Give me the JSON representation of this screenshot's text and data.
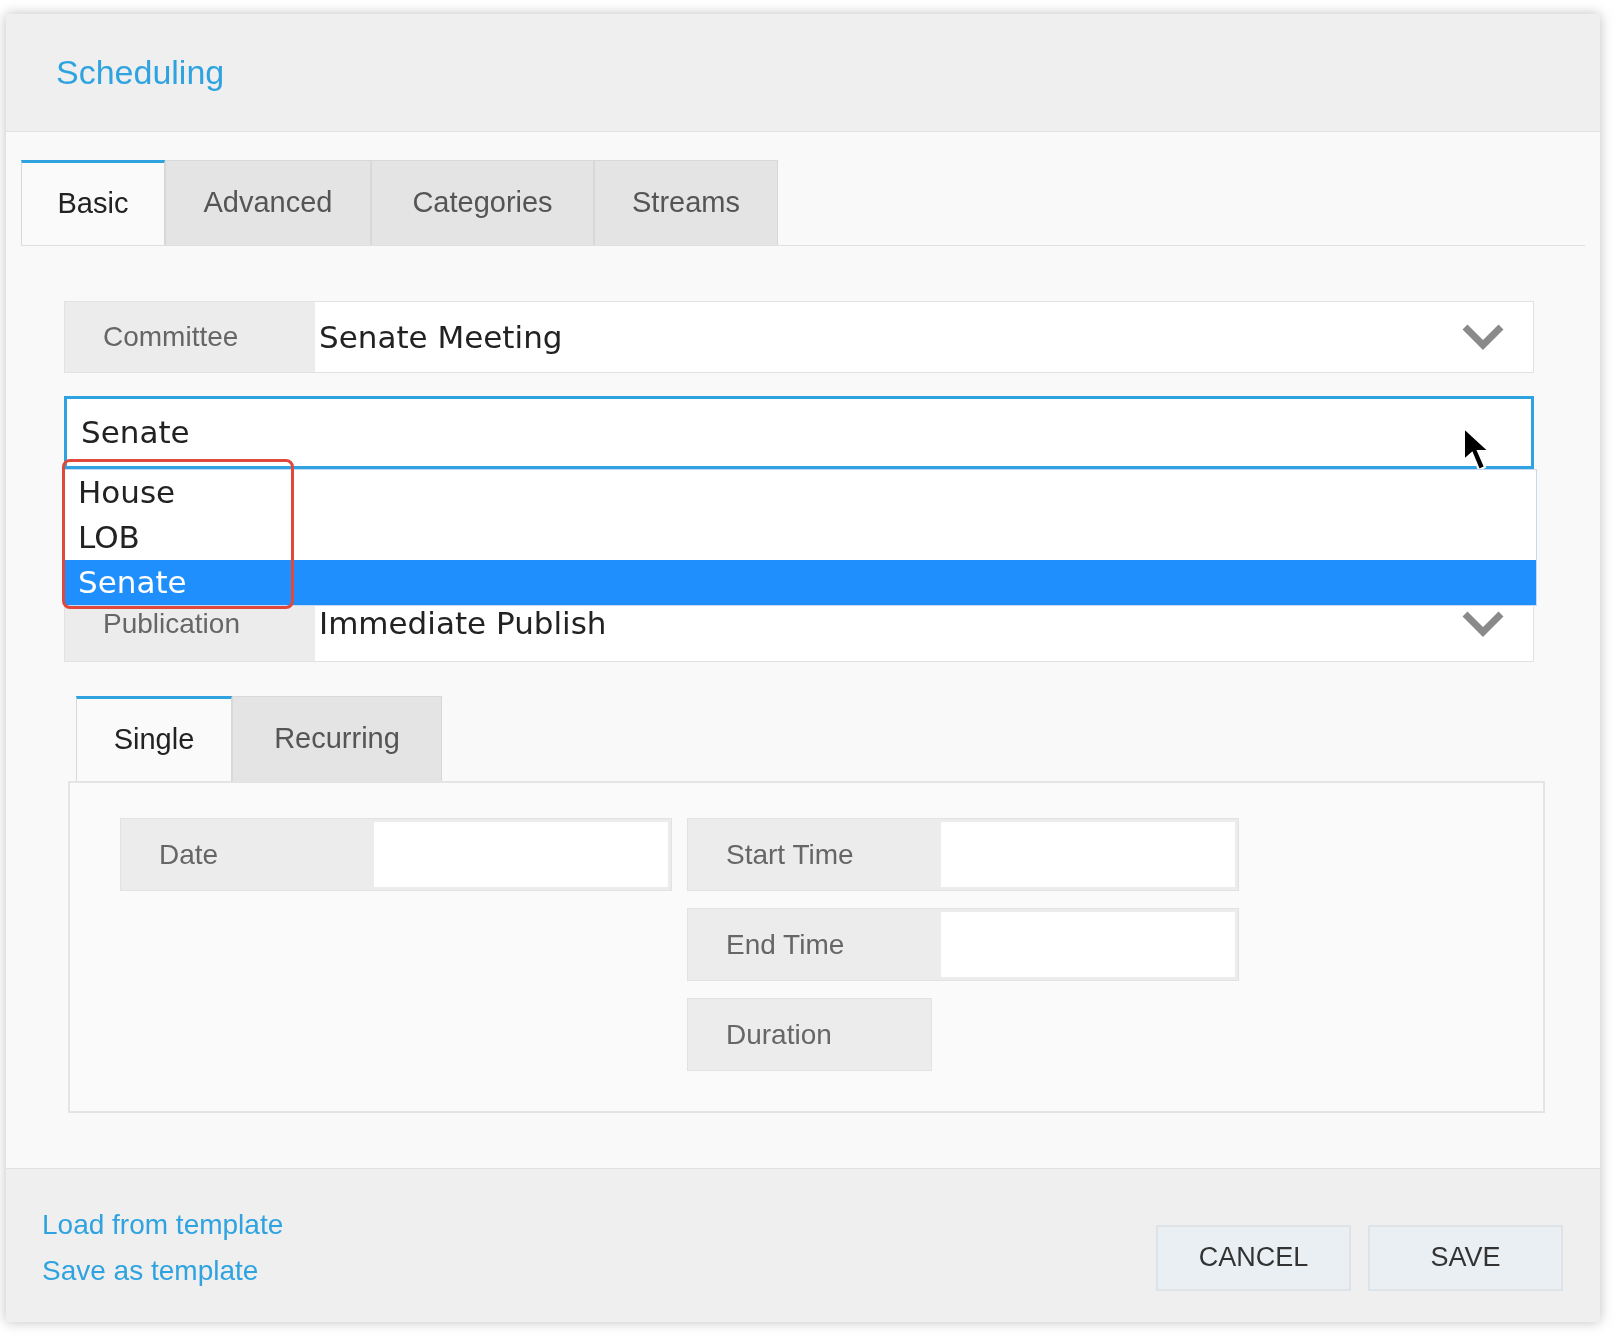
{
  "dialog": {
    "title": "Scheduling"
  },
  "tabs": [
    {
      "label": "Basic",
      "selected": true
    },
    {
      "label": "Advanced",
      "selected": false
    },
    {
      "label": "Categories",
      "selected": false
    },
    {
      "label": "Streams",
      "selected": false
    }
  ],
  "committee": {
    "label": "Committee",
    "value": "Senate Meeting"
  },
  "location": {
    "value": "Senate",
    "expanded": true,
    "options": [
      {
        "label": "House",
        "selected": false
      },
      {
        "label": "LOB",
        "selected": false
      },
      {
        "label": "Senate",
        "selected": true
      }
    ]
  },
  "publication": {
    "label": "Publication",
    "value": "Immediate Publish"
  },
  "schedule_tabs": [
    {
      "label": "Single",
      "selected": true
    },
    {
      "label": "Recurring",
      "selected": false
    }
  ],
  "schedule_columns": [
    {
      "fields": [
        {
          "label": "Date",
          "kind": "input"
        }
      ]
    },
    {
      "fields": [
        {
          "label": "Start Time",
          "kind": "input"
        },
        {
          "label": "End Time",
          "kind": "input"
        },
        {
          "label": "Duration",
          "kind": "label"
        }
      ]
    }
  ],
  "footer": {
    "links": [
      "Load from template",
      "Save as template"
    ],
    "buttons": [
      "CANCEL",
      "SAVE"
    ]
  }
}
